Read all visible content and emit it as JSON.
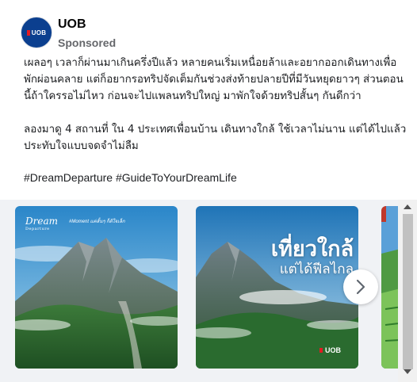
{
  "post": {
    "author": "UOB",
    "sponsored_label": "Sponsored",
    "avatar_text": "UOB",
    "paragraphs": [
      "เผลอๆ เวลาก็ผ่านมาเกินครึ่งปีแล้ว หลายคนเริ่มเหนื่อยล้าและอยากออกเดินทางเพื่อพักผ่อนคลาย แต่ก็อยากรอทริปจัดเต็มกันช่วงส่งท้ายปลายปีที่มีวันหยุดยาวๆ ส่วนตอนนี้ถ้าใครรอไม่ไหว ก่อนจะไปแพลนทริปใหญ่ มาพักใจด้วยทริปสั้นๆ กันดีกว่า",
      "ลองมาดู 4 สถานที่ ใน 4 ประเทศเพื่อนบ้าน เดินทางใกล้ ใช้เวลาไม่นาน แต่ได้ไปแล้วประทับใจแบบจดจำไม่ลืม"
    ],
    "hashtags": "#DreamDeparture #GuideToYourDreamLife"
  },
  "carousel": {
    "card1": {
      "brand_main": "Dream",
      "brand_sub": "Departure",
      "tagline": "#Moment แค่สั้นๆ ก็ดีใจเล็ก"
    },
    "card2": {
      "title": "เที่ยวใกล้",
      "subtitle": "แต่ได้ฟีลไกล",
      "logo": "UOB"
    }
  },
  "icons": {
    "next": "chevron-right-icon",
    "scroll_up": "arrow-up-icon",
    "scroll_down": "arrow-down-icon"
  },
  "colors": {
    "brand_blue": "#0b3f8f",
    "brand_red": "#e31b23"
  }
}
